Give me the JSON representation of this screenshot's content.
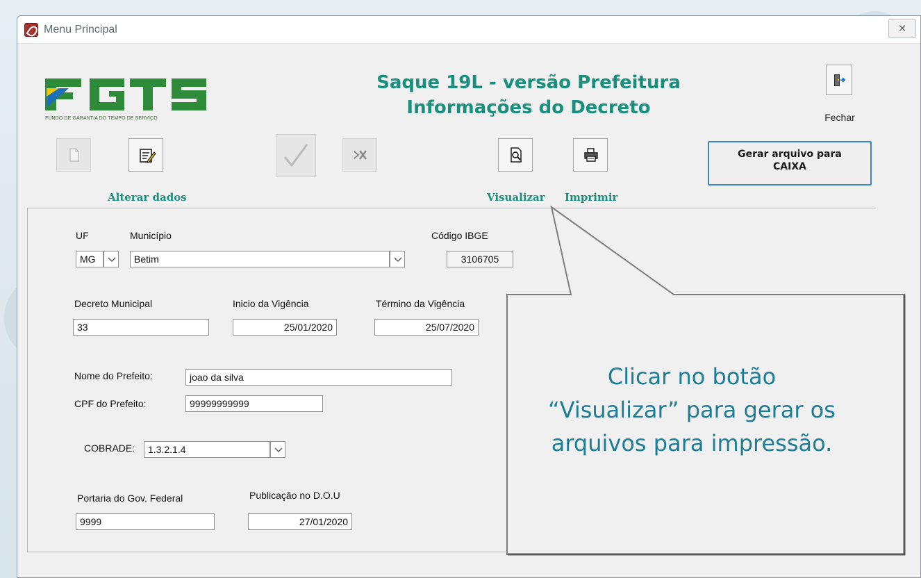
{
  "window": {
    "title": "Menu Principal",
    "close_glyph": "✕"
  },
  "logo": {
    "letters": "FGTS",
    "tagline": "FUNDO DE GARANTIA DO TEMPO DE SERVIÇO"
  },
  "header": {
    "title_line1": "Saque 19L - versão Prefeitura",
    "title_line2": "Informações do Decreto",
    "exit_label": "Fechar"
  },
  "toolbar": {
    "new_icon": "new-document-icon",
    "edit_icon": "edit-document-icon",
    "confirm_icon": "checkmark-icon",
    "cancel_icon": "cancel-edit-icon",
    "preview_icon": "print-preview-icon",
    "print_icon": "printer-icon",
    "edit_label": "Alterar dados",
    "preview_label": "Visualizar",
    "print_label": "Imprimir",
    "generate_label_line1": "Gerar arquivo para",
    "generate_label_line2": "CAIXA"
  },
  "form": {
    "uf_label": "UF",
    "uf_value": "MG",
    "municipio_label": "Município",
    "municipio_value": "Betim",
    "ibge_label": "Código IBGE",
    "ibge_value": "3106705",
    "decreto_label": "Decreto Municipal",
    "decreto_value": "33",
    "inicio_label": "Inicio da Vigência",
    "inicio_value": "25/01/2020",
    "termino_label": "Término da Vigência",
    "termino_value": "25/07/2020",
    "prefeito_label": "Nome do Prefeito:",
    "prefeito_value": "joao da silva",
    "cpf_label": "CPF do Prefeito:",
    "cpf_value": "99999999999",
    "cobrade_label": "COBRADE:",
    "cobrade_value": "1.3.2.1.4",
    "portaria_label": "Portaria do Gov. Federal",
    "portaria_value": "9999",
    "publicacao_label": "Publicação no D.O.U",
    "publicacao_value": "27/01/2020"
  },
  "callout": {
    "line1": "Clicar no botão",
    "line2": "“Visualizar” para gerar os",
    "line3": "arquivos para impressão."
  },
  "colors": {
    "accent_teal": "#1b8f7e",
    "callout_text": "#1c7e96",
    "button_focus": "#3b84c9",
    "logo_green": "#2e8b3a",
    "logo_blue": "#1e6fb8",
    "logo_yellow": "#f2c500"
  }
}
